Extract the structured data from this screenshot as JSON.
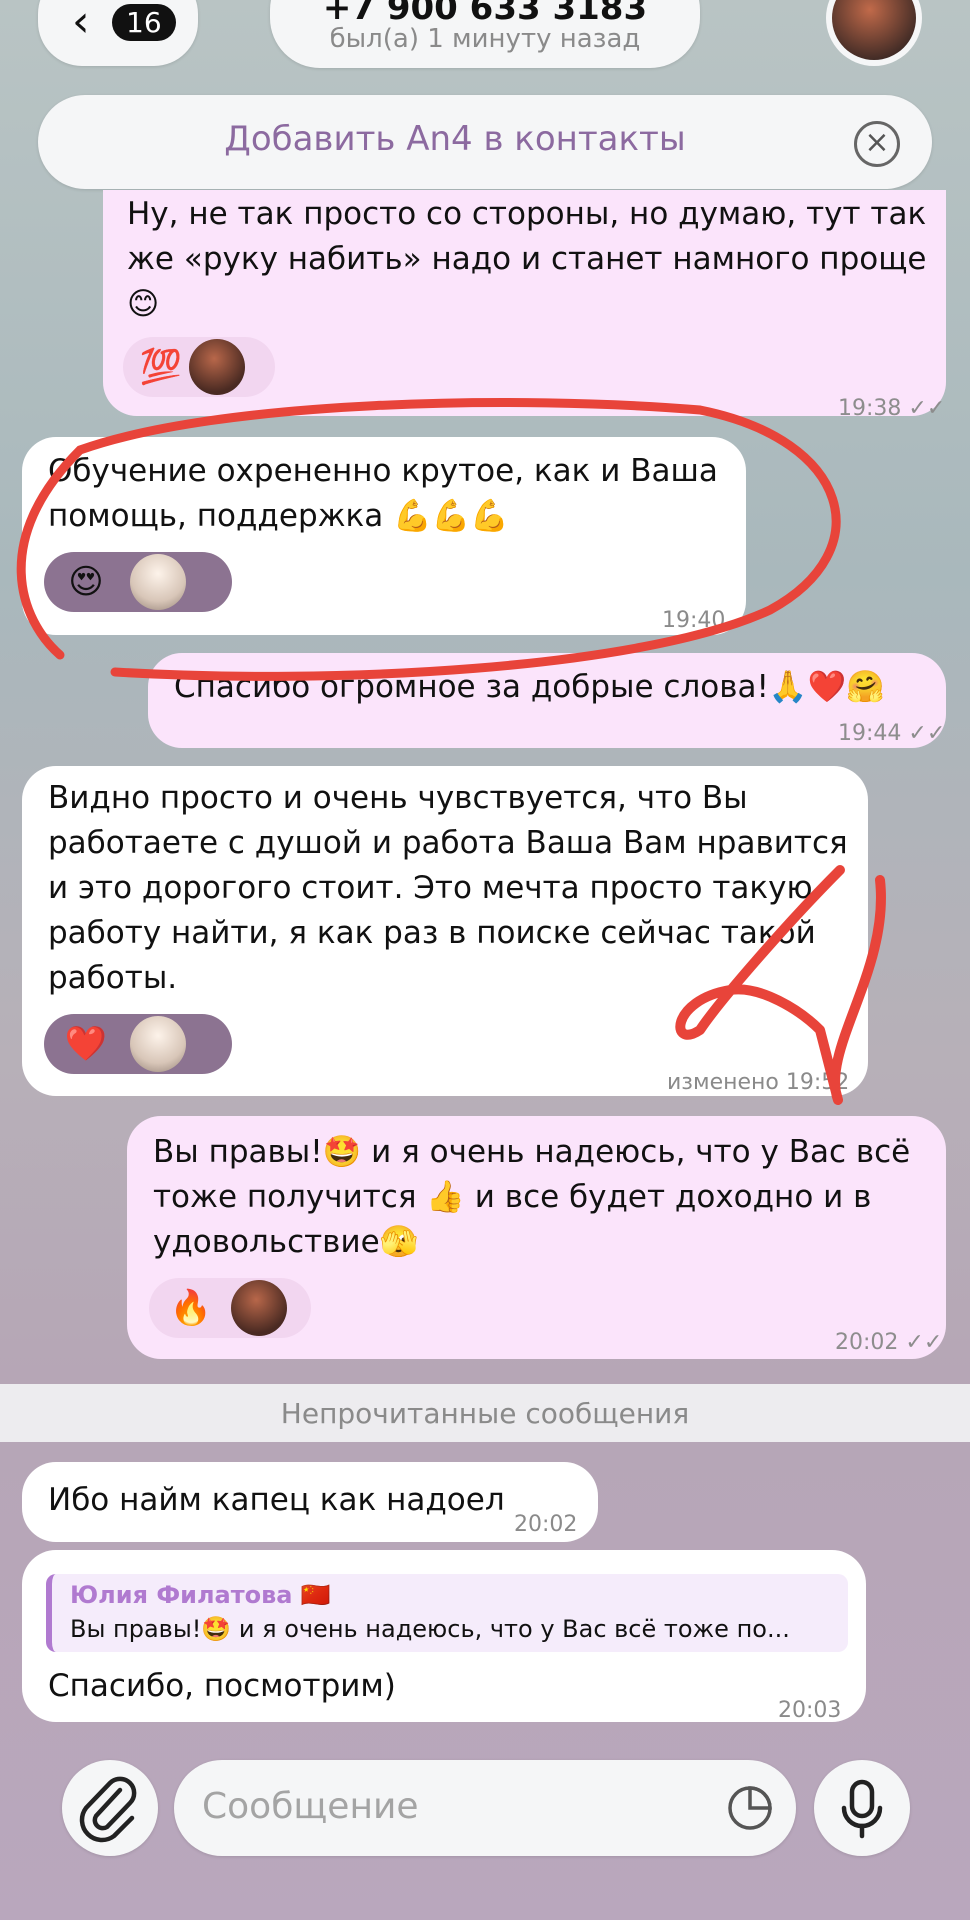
{
  "header": {
    "back_count": "16",
    "contact_title": "+7 900 633 3183",
    "contact_status": "был(а) 1 минуту назад"
  },
  "add_banner": {
    "label": "Добавить An4 в контакты"
  },
  "messages": [
    {
      "dir": "out",
      "text": "Ну, не так просто со стороны, но думаю, тут так\nже «руку набить» надо и станет намного проще\n😊",
      "reaction": "💯",
      "time": "19:38"
    },
    {
      "dir": "in",
      "text": "Обучение охрененно крутое, как и Ваша\nпомощь, поддержка 💪💪💪",
      "reaction": "😍",
      "time": "19:40"
    },
    {
      "dir": "out",
      "text": "Спасибо огромное за добрые слова!🙏❤️🤗",
      "time": "19:44"
    },
    {
      "dir": "in",
      "text": "Видно просто и очень чувствуется, что Вы\nработаете с душой и работа Ваша Вам нравится\nи это дорогого стоит. Это мечта просто такую\nработу найти, я как раз в поиске сейчас такой\nработы.",
      "reaction": "❤️",
      "time": "изменено 19:52"
    },
    {
      "dir": "out",
      "text": "Вы правы!🤩 и я очень надеюсь, что у Вас всё\nтоже получится 👍 и все будет доходно и в\nудовольствие🫣",
      "reaction": "🔥",
      "time": "20:02"
    }
  ],
  "unread_label": "Непрочитанные сообщения",
  "unread_messages": [
    {
      "text": "Ибо найм капец как надоел",
      "time": "20:02"
    },
    {
      "reply_author": "Юлия Филатова 🇨🇳",
      "reply_text": "Вы правы!🤩 и я очень надеюсь, что у Вас всё тоже по...",
      "text": "Спасибо, посмотрим)",
      "time": "20:03"
    }
  ],
  "composer": {
    "placeholder": "Сообщение"
  },
  "colors": {
    "accent": "#b07ad0",
    "outgoing_bubble": "#fbe4fb",
    "annotation_red": "#e8443a"
  }
}
